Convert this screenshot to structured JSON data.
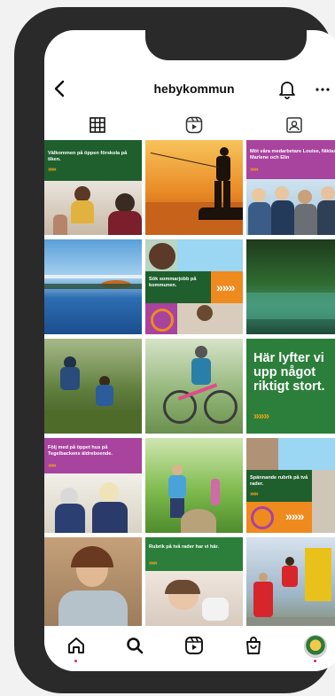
{
  "header": {
    "username": "hebykommun"
  },
  "colors": {
    "green": "#1f5f2d",
    "purple": "#a8439e",
    "orange": "#ef8a1e",
    "light_blue": "#9bd6f2"
  },
  "tabs": [
    {
      "icon": "grid-icon"
    },
    {
      "icon": "reels-icon"
    },
    {
      "icon": "tagged-icon"
    }
  ],
  "posts": [
    {
      "caption": "Välkommen på öppen förskola på tiken.",
      "arrows": "»»»"
    },
    {
      "caption": ""
    },
    {
      "caption": "Möt våra medarbetare Louise, Niklas, Marlene och Elin",
      "arrows": "»»»"
    },
    {
      "caption": ""
    },
    {
      "caption": "Sök sommarjobb på kommunen.",
      "arrows": "»»»"
    },
    {
      "caption": ""
    },
    {
      "caption": ""
    },
    {
      "caption": ""
    },
    {
      "caption": "Här lyfter vi upp något riktigt stort.",
      "arrows": "»»»"
    },
    {
      "caption": "Följ med på öppet hus på Tegelbackens äldreboende.",
      "arrows": "»»»"
    },
    {
      "caption": ""
    },
    {
      "caption": "Spännande rubrik på två rader.",
      "arrows": "»»»"
    },
    {
      "caption": ""
    },
    {
      "caption": "Rubrik på två rader har vi här.",
      "arrows": "»»»"
    },
    {
      "caption": ""
    }
  ],
  "bottom_nav": [
    {
      "icon": "home-icon"
    },
    {
      "icon": "search-icon"
    },
    {
      "icon": "reels-icon"
    },
    {
      "icon": "shop-icon"
    },
    {
      "icon": "profile-avatar"
    }
  ]
}
